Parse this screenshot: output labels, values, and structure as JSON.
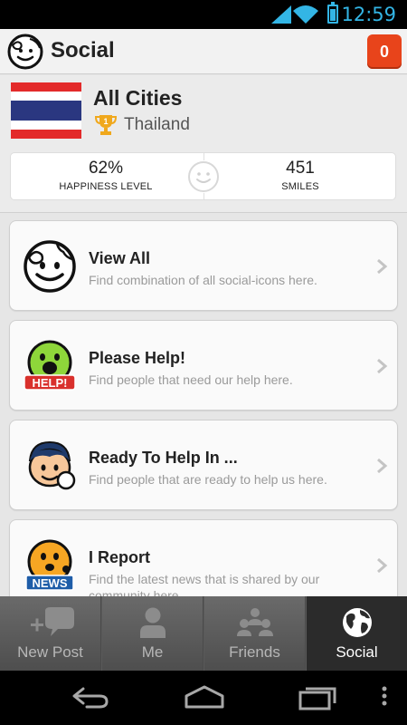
{
  "status_bar": {
    "time": "12:59"
  },
  "header": {
    "title": "Social",
    "notification_count": "0"
  },
  "location": {
    "city": "All Cities",
    "country": "Thailand",
    "stats": {
      "happiness_value": "62%",
      "happiness_label": "HAPPINESS LEVEL",
      "smiles_value": "451",
      "smiles_label": "SMILES"
    }
  },
  "menu": {
    "items": [
      {
        "title": "View All",
        "desc": "Find combination of all social-icons here.",
        "icon": "globe-smiley-icon"
      },
      {
        "title": "Please Help!",
        "desc": "Find people that need our help here.",
        "icon": "help-smiley-icon",
        "badge": "HELP!"
      },
      {
        "title": "Ready To Help In ...",
        "desc": "Find people that are ready to help us here.",
        "icon": "helper-person-icon"
      },
      {
        "title": "I Report",
        "desc": "Find the latest news that is shared by our community here.",
        "icon": "news-smiley-icon",
        "badge": "NEWS"
      }
    ]
  },
  "tabs": [
    {
      "label": "New Post",
      "icon": "new-post-icon"
    },
    {
      "label": "Me",
      "icon": "person-icon"
    },
    {
      "label": "Friends",
      "icon": "friends-icon"
    },
    {
      "label": "Social",
      "icon": "globe-icon",
      "active": true
    }
  ],
  "colors": {
    "accent_orange": "#e8441b",
    "status_blue": "#33b5e5",
    "help_green": "#8ed63a",
    "news_orange": "#f6a623",
    "badge_red": "#d9302c",
    "badge_blue": "#1e5da8"
  }
}
